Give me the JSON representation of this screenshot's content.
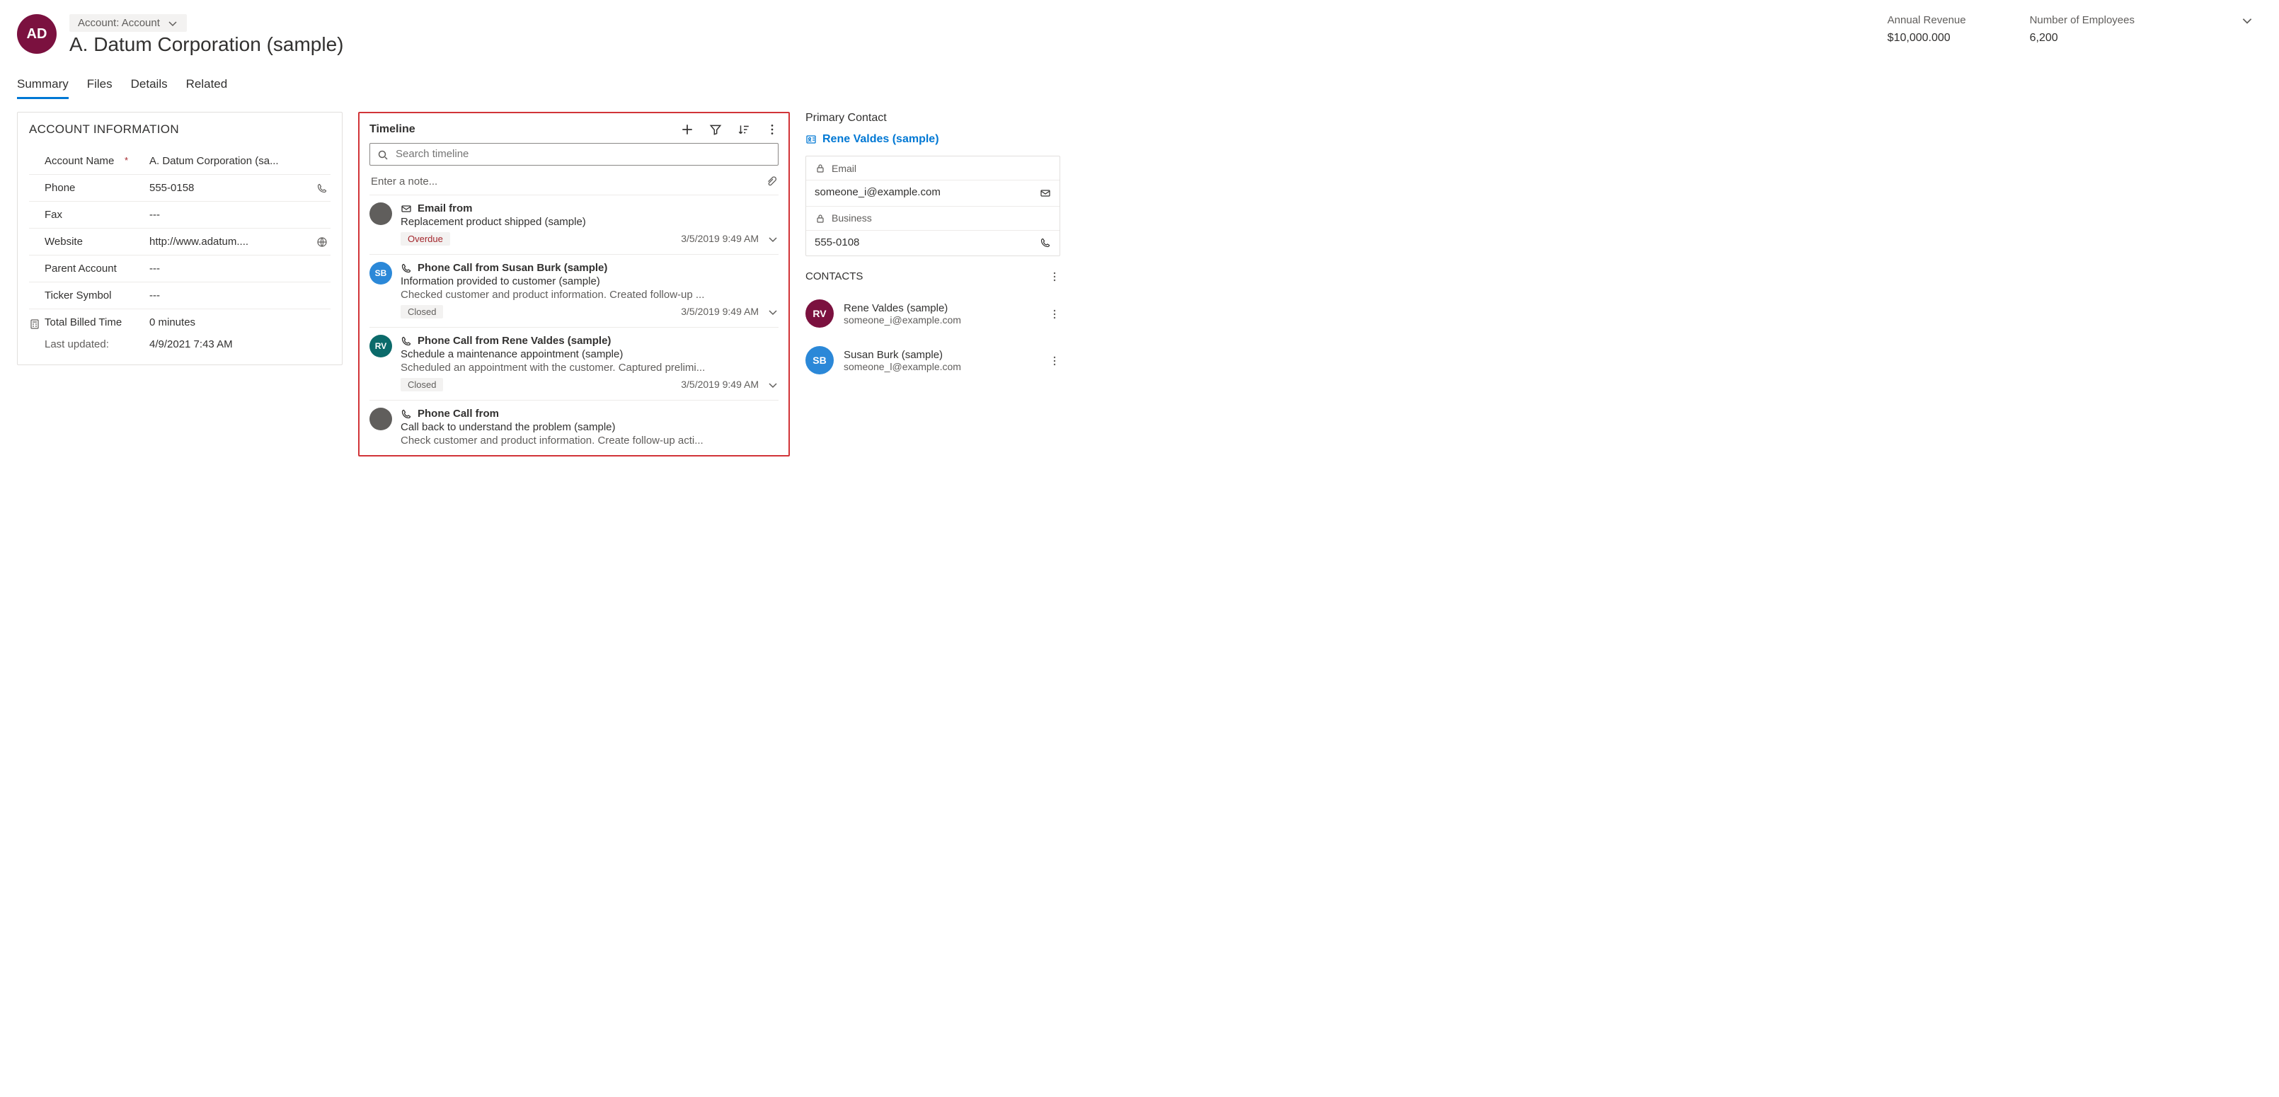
{
  "header": {
    "avatar_initials": "AD",
    "entity_badge": "Account: Account",
    "entity_name": "A. Datum Corporation (sample)",
    "stat1_label": "Annual Revenue",
    "stat1_value": "$10,000.000",
    "stat2_label": "Number of Employees",
    "stat2_value": "6,200"
  },
  "tabs": {
    "t0": "Summary",
    "t1": "Files",
    "t2": "Details",
    "t3": "Related"
  },
  "account_info": {
    "title": "ACCOUNT INFORMATION",
    "fields": {
      "account_name_label": "Account Name",
      "account_name_value": "A. Datum Corporation (sa...",
      "phone_label": "Phone",
      "phone_value": "555-0158",
      "fax_label": "Fax",
      "fax_value": "---",
      "website_label": "Website",
      "website_value": "http://www.adatum....",
      "parent_label": "Parent Account",
      "parent_value": "---",
      "ticker_label": "Ticker Symbol",
      "ticker_value": "---",
      "billed_label": "Total Billed Time",
      "billed_value": "0 minutes",
      "last_updated_label": "Last updated:",
      "last_updated_value": "4/9/2021 7:43 AM"
    }
  },
  "timeline": {
    "title": "Timeline",
    "search_placeholder": "Search timeline",
    "note_placeholder": "Enter a note...",
    "items": [
      {
        "avatar": "",
        "avatar_class": "tl-gray",
        "kind": "Email from",
        "icon": "mail",
        "subject": "Replacement product shipped (sample)",
        "desc": "",
        "badge": "Overdue",
        "badge_style": "red",
        "date": "3/5/2019 9:49 AM"
      },
      {
        "avatar": "SB",
        "avatar_class": "tl-blue",
        "kind": "Phone Call from Susan Burk (sample)",
        "icon": "phone",
        "subject": "Information provided to customer (sample)",
        "desc": "Checked customer and product information. Created follow-up ...",
        "badge": "Closed",
        "badge_style": "gray",
        "date": "3/5/2019 9:49 AM"
      },
      {
        "avatar": "RV",
        "avatar_class": "tl-teal",
        "kind": "Phone Call from Rene Valdes (sample)",
        "icon": "phone",
        "subject": "Schedule a maintenance appointment (sample)",
        "desc": "Scheduled an appointment with the customer. Captured prelimi...",
        "badge": "Closed",
        "badge_style": "gray",
        "date": "3/5/2019 9:49 AM"
      },
      {
        "avatar": "",
        "avatar_class": "tl-gray",
        "kind": "Phone Call from",
        "icon": "phone",
        "subject": "Call back to understand the problem (sample)",
        "desc": "Check customer and product information. Create follow-up acti...",
        "badge": "",
        "badge_style": "",
        "date": ""
      }
    ]
  },
  "primary_contact": {
    "title": "Primary Contact",
    "link_text": "Rene Valdes (sample)",
    "email_label": "Email",
    "email_value": "someone_i@example.com",
    "business_label": "Business",
    "business_value": "555-0108"
  },
  "contacts": {
    "title": "CONTACTS",
    "list": [
      {
        "initials": "RV",
        "avatar_class": "c-purple",
        "name": "Rene Valdes (sample)",
        "email": "someone_i@example.com"
      },
      {
        "initials": "SB",
        "avatar_class": "c-blue",
        "name": "Susan Burk (sample)",
        "email": "someone_l@example.com"
      }
    ]
  }
}
